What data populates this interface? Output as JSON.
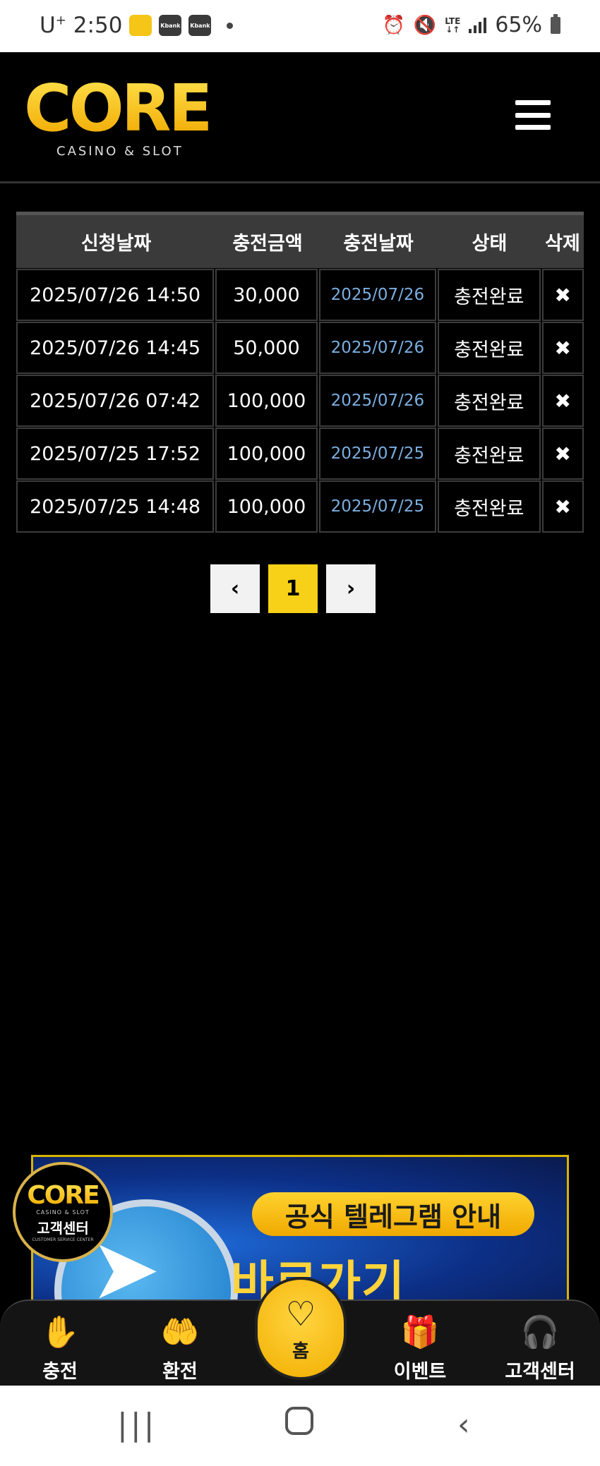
{
  "status_bar": {
    "carrier": "U",
    "carrier_plus": "+",
    "time": "2:50",
    "badges": [
      "",
      "Kbank",
      "Kbank"
    ],
    "signal_type_top": "LTE",
    "signal_type_bottom": "↓↑",
    "battery": "65%"
  },
  "header": {
    "logo_word": "CORE",
    "logo_sub": "CASINO & SLOT"
  },
  "history": {
    "columns": [
      "신청날짜",
      "충전금액",
      "충전날짜",
      "상태",
      "삭제"
    ],
    "rows": [
      {
        "request": "2025/07/26 14:50",
        "amount": "30,000",
        "date": "2025/07/26",
        "status": "충전완료",
        "delete": "✖"
      },
      {
        "request": "2025/07/26 14:45",
        "amount": "50,000",
        "date": "2025/07/26",
        "status": "충전완료",
        "delete": "✖"
      },
      {
        "request": "2025/07/26 07:42",
        "amount": "100,000",
        "date": "2025/07/26",
        "status": "충전완료",
        "delete": "✖"
      },
      {
        "request": "2025/07/25 17:52",
        "amount": "100,000",
        "date": "2025/07/25",
        "status": "충전완료",
        "delete": "✖"
      },
      {
        "request": "2025/07/25 14:48",
        "amount": "100,000",
        "date": "2025/07/25",
        "status": "충전완료",
        "delete": "✖"
      }
    ]
  },
  "pagination": {
    "prev": "‹",
    "current": "1",
    "next": "›"
  },
  "banner": {
    "pill_text": "공식 텔레그램 안내",
    "cta_text": "바로가기 CLICK"
  },
  "cs_badge": {
    "logo": "CORE",
    "sub": "CASINO & SLOT",
    "title": "고객센터",
    "en": "CUSTOMER SERVICE CENTER"
  },
  "bottom_nav": {
    "deposit": "충전",
    "withdraw": "환전",
    "home": "홈",
    "event": "이벤트",
    "support": "고객센터"
  },
  "colors": {
    "accent": "#f7d117",
    "date_link": "#7aaee0",
    "background": "#000000"
  }
}
